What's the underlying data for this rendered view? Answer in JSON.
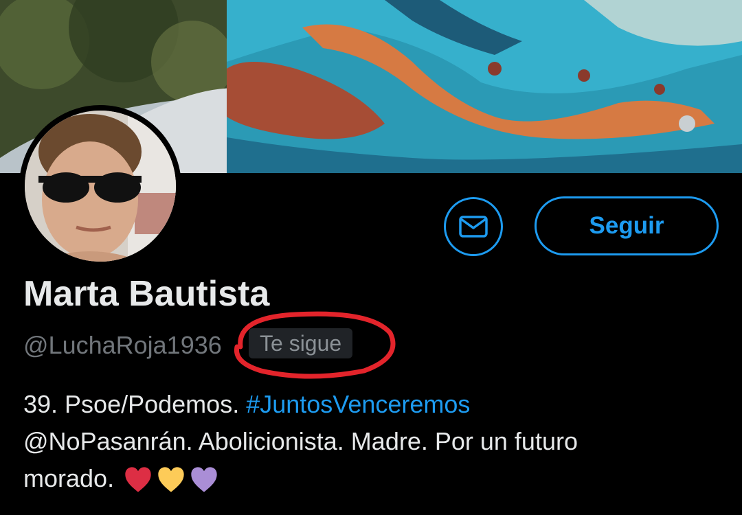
{
  "profile": {
    "name": "Marta Bautista",
    "handle": "@LuchaRoja1936",
    "follows_you_badge": "Te sigue",
    "bio": {
      "line1_prefix": "39. Psoe/Podemos. ",
      "hashtag": "#JuntosVenceremos",
      "line2": "@NoPasanrán. Abolicionista. Madre. Por un futuro",
      "line3": "morado."
    }
  },
  "actions": {
    "message_icon": "envelope-icon",
    "follow_label": "Seguir"
  },
  "emoji": [
    "red-heart",
    "yellow-heart",
    "purple-heart"
  ],
  "colors": {
    "accent": "#1d9bf0",
    "background": "#000000",
    "annotation": "#e3242b",
    "red_heart": "#dd2e44",
    "yellow_heart": "#fdcb58",
    "purple_heart": "#aa8ed6"
  }
}
